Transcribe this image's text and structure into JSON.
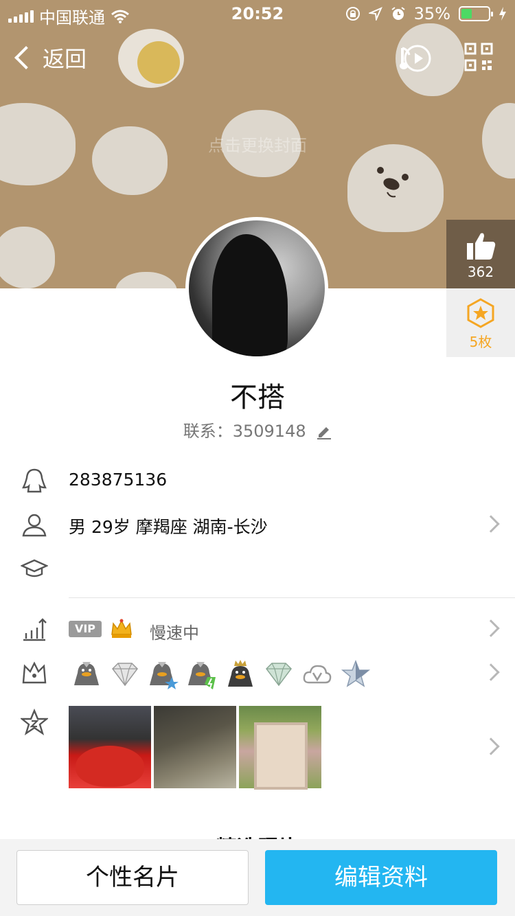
{
  "status_bar": {
    "carrier": "中国联通",
    "time": "20:52",
    "battery_pct": "35%",
    "icons": [
      "signal-icon",
      "wifi-icon",
      "lock-rotation-icon",
      "location-icon",
      "alarm-icon",
      "battery-icon",
      "charging-icon"
    ]
  },
  "nav": {
    "back_label": "返回",
    "icons": [
      "back-chevron-icon",
      "music-play-icon",
      "qr-code-icon"
    ]
  },
  "cover": {
    "hint": "点击更换封面"
  },
  "side": {
    "likes": "362",
    "medals": "5枚",
    "icons": [
      "thumbs-up-icon",
      "medal-star-icon"
    ]
  },
  "profile": {
    "nickname": "不搭",
    "contact": "联系：3509148"
  },
  "info": {
    "qq_number": "283875136",
    "basic": "男 29岁 摩羯座 湖南-长沙",
    "school": ""
  },
  "vip": {
    "badge": "VIP",
    "status": "慢速中"
  },
  "badges": [
    "penguin-grey-badge",
    "diamond-badge",
    "penguin-star-badge",
    "penguin-bolt-badge",
    "penguin-crown-badge",
    "diamond-green-badge",
    "cloud-v-badge",
    "star-badge"
  ],
  "photos_count": 3,
  "section": {
    "peek_title": "精选照片"
  },
  "buttons": {
    "card": "个性名片",
    "edit": "编辑资料"
  },
  "colors": {
    "cover": "#b2956f",
    "accent": "#23b6f1",
    "medal": "#f5a623",
    "like_box": "#6f5d48"
  }
}
